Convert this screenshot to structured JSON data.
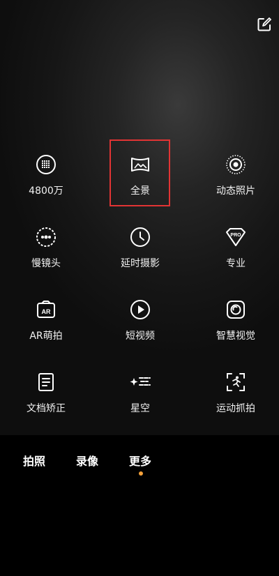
{
  "camera_more": {
    "edit_icon": "edit-icon",
    "items": [
      {
        "label": "4800万",
        "icon": "high-resolution-grid-icon"
      },
      {
        "label": "全景",
        "icon": "panorama-icon"
      },
      {
        "label": "动态照片",
        "icon": "live-photo-icon"
      },
      {
        "label": "慢镜头",
        "icon": "slow-motion-icon"
      },
      {
        "label": "延时摄影",
        "icon": "timelapse-clock-icon"
      },
      {
        "label": "专业",
        "icon": "pro-mode-icon"
      },
      {
        "label": "AR萌拍",
        "icon": "ar-icon"
      },
      {
        "label": "短视频",
        "icon": "short-video-icon"
      },
      {
        "label": "智慧视觉",
        "icon": "smart-vision-icon"
      },
      {
        "label": "文档矫正",
        "icon": "document-icon"
      },
      {
        "label": "星空",
        "icon": "starry-sky-icon"
      },
      {
        "label": "运动抓拍",
        "icon": "sports-capture-icon"
      }
    ],
    "highlighted_item": "全景"
  },
  "mode_bar": {
    "modes": [
      "拍照",
      "录像",
      "更多"
    ],
    "active_mode": "更多",
    "indicator_color": "#f5a13a"
  },
  "colors": {
    "highlight_border": "#e23434"
  }
}
